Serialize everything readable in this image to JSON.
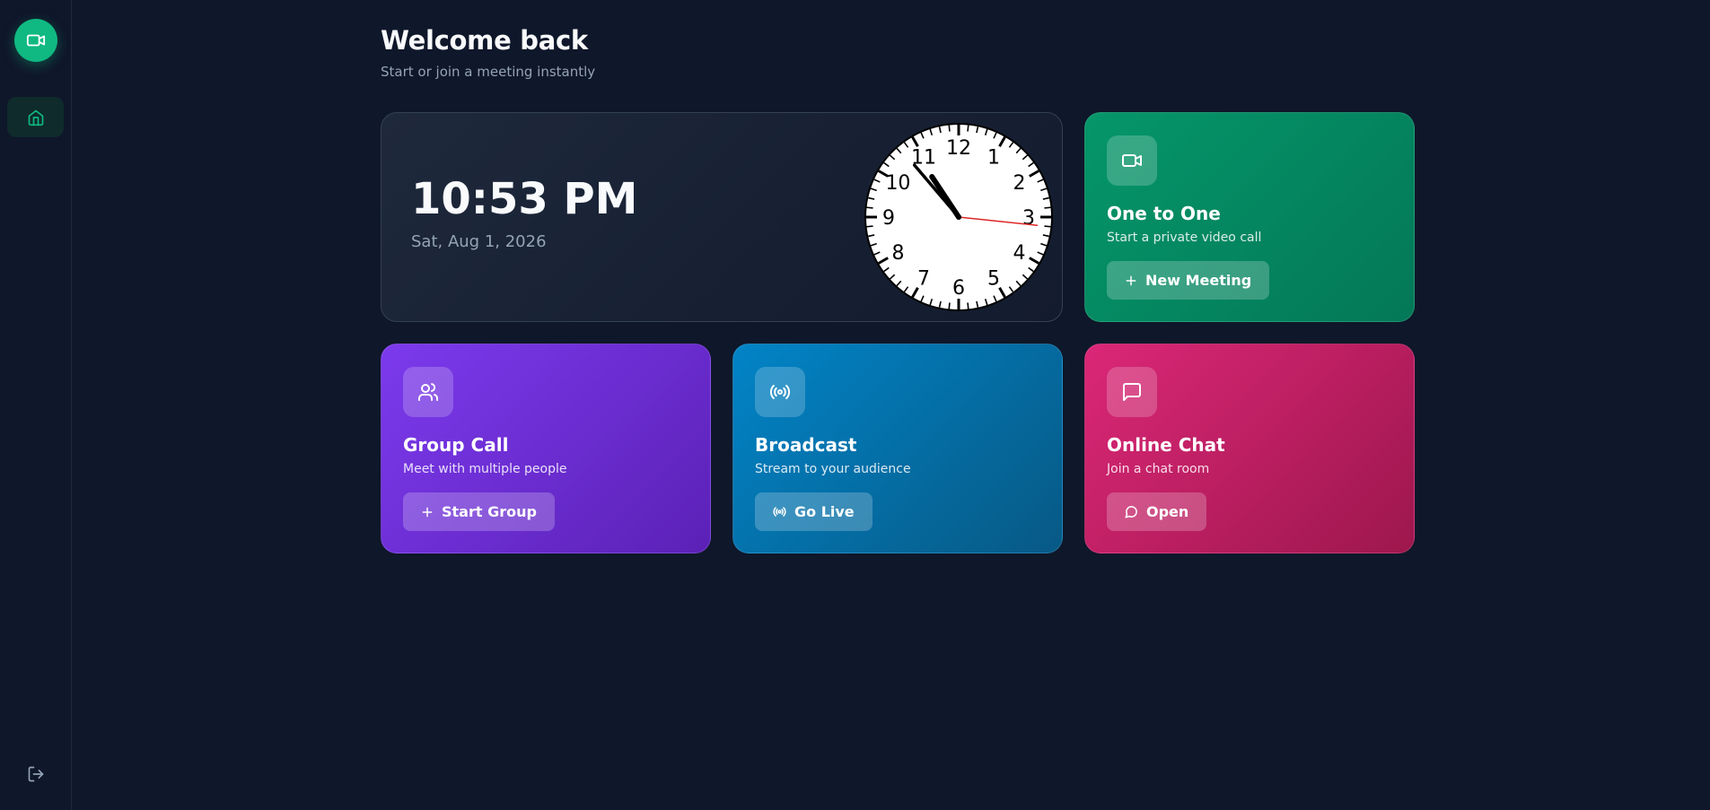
{
  "sidebar": {
    "logo_icon": "video-camera-icon",
    "items": [
      {
        "icon": "home-icon",
        "active": true
      }
    ],
    "logout_icon": "logout-icon"
  },
  "header": {
    "title": "Welcome back",
    "subtitle": "Start or join a meeting instantly"
  },
  "clock": {
    "time": "10:53 PM",
    "date": "Sat, Aug 1, 2026",
    "numerals": [
      "12",
      "1",
      "2",
      "3",
      "4",
      "5",
      "6",
      "7",
      "8",
      "9",
      "10",
      "11"
    ],
    "hour": 22,
    "minute": 53,
    "second": 16
  },
  "cards": [
    {
      "title": "One to One",
      "description": "Start a private video call",
      "button": "New Meeting",
      "icon": "video-camera-icon",
      "button_icon": "plus-icon",
      "color": "#059669"
    },
    {
      "title": "Group Call",
      "description": "Meet with multiple people",
      "button": "Start Group",
      "icon": "users-icon",
      "button_icon": "plus-icon",
      "color": "#7c3aed"
    },
    {
      "title": "Broadcast",
      "description": "Stream to your audience",
      "button": "Go Live",
      "icon": "broadcast-icon",
      "button_icon": "broadcast-icon",
      "color": "#0284c7"
    },
    {
      "title": "Online Chat",
      "description": "Join a chat room",
      "button": "Open",
      "icon": "chat-icon",
      "button_icon": "chat-bubble-icon",
      "color": "#db2777"
    }
  ],
  "colors": {
    "background": "#0f172a",
    "accent": "#10b981",
    "second_hand": "#dc2626"
  }
}
